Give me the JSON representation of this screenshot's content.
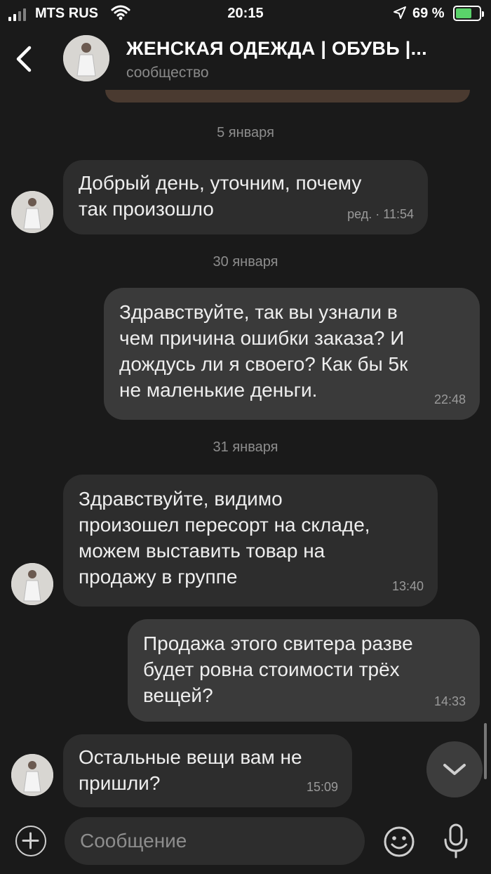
{
  "status_bar": {
    "carrier": "MTS RUS",
    "time": "20:15",
    "battery_percent": "69 %",
    "battery_level": 0.69,
    "battery_charging": true
  },
  "header": {
    "title": "ЖЕНСКАЯ ОДЕЖДА | ОБУВЬ |...",
    "subtitle": "сообщество"
  },
  "date_separators": [
    "5 января",
    "30 января",
    "31 января"
  ],
  "messages": [
    {
      "direction": "incoming",
      "lines": [
        "Добрый день, уточним, почему",
        "так произошло"
      ],
      "meta": "ред. · 11:54"
    },
    {
      "direction": "outgoing",
      "lines": [
        "Здравствуйте, так вы узнали в",
        "чем причина ошибки заказа? И",
        "дождусь ли я своего?  Как бы 5к",
        "не маленькие деньги."
      ],
      "meta": "22:48"
    },
    {
      "direction": "incoming",
      "lines": [
        "Здравствуйте, видимо",
        "произошел пересорт на складе,",
        "можем выставить товар на",
        "продажу в группе"
      ],
      "meta": "13:40"
    },
    {
      "direction": "outgoing",
      "lines": [
        "Продажа этого свитера разве",
        "будет ровна стоимости трёх",
        "вещей?"
      ],
      "meta": "14:33"
    },
    {
      "direction": "incoming",
      "lines": [
        "Остальные вещи вам не",
        "пришли?"
      ],
      "meta": "15:09"
    }
  ],
  "composer": {
    "placeholder": "Сообщение"
  },
  "icons": {
    "back": "chevron-left-icon",
    "scroll_down": "chevron-down-icon",
    "add": "plus-icon",
    "emoji": "smile-icon",
    "mic": "microphone-icon"
  },
  "colors": {
    "background": "#1a1a1a",
    "incoming_bubble": "#2d2d2d",
    "outgoing_bubble": "#3a3a3a",
    "battery_fill": "#5ad36a"
  }
}
